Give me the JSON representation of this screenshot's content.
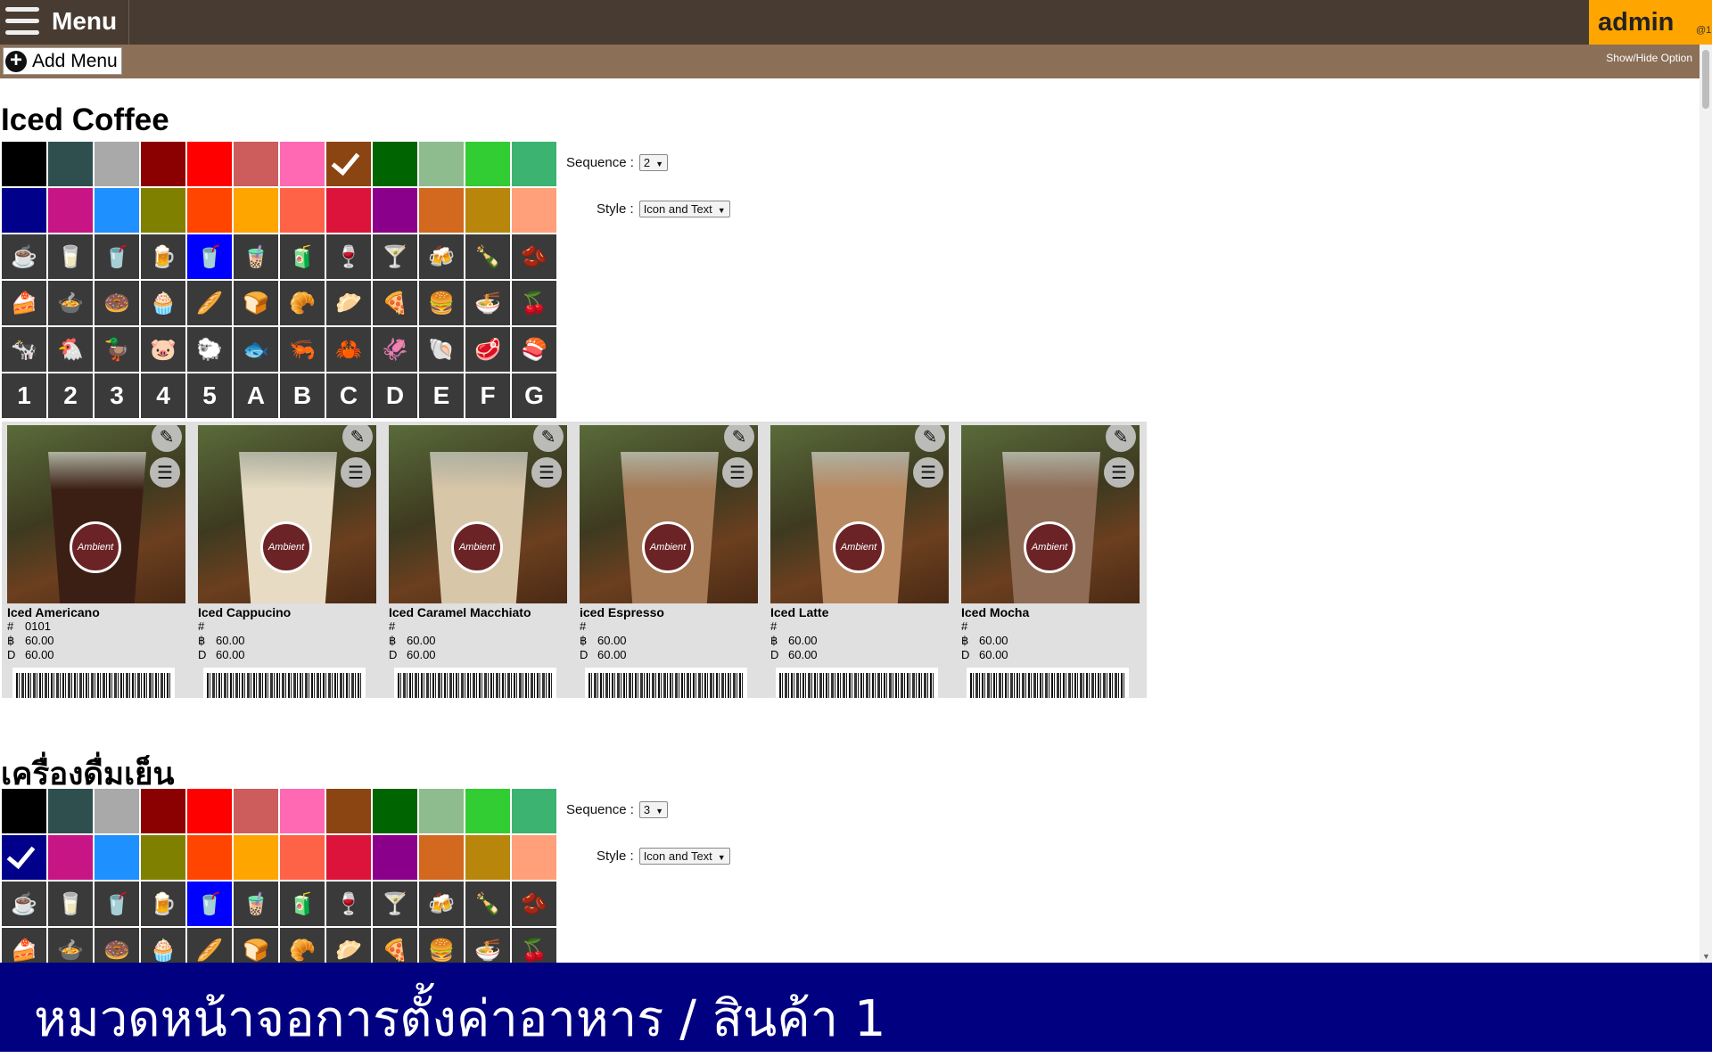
{
  "header": {
    "menu_label": "Menu",
    "user": "admin",
    "user_sub": "@1"
  },
  "toolbar": {
    "add_menu_label": "Add Menu",
    "show_hide_label": "Show/Hide Option"
  },
  "colors": [
    "#000000",
    "#2f4f4f",
    "#a9a9a9",
    "#8b0000",
    "#ff0000",
    "#cd5c5c",
    "#ff69b4",
    "#8b4513",
    "#006400",
    "#8fbc8f",
    "#32cd32",
    "#3cb371",
    "#00008b",
    "#c71585",
    "#1e90ff",
    "#808000",
    "#ff4500",
    "#ffa500",
    "#ff6347",
    "#dc143c",
    "#8b008b",
    "#d2691e",
    "#b8860b",
    "#ffa07a"
  ],
  "icons_row1": [
    "☕",
    "🥛",
    "🥤",
    "🍺",
    "🥤",
    "🧋",
    "🧃",
    "🍷",
    "🍸",
    "🍻",
    "🍾",
    "🫘"
  ],
  "icons_row2": [
    "🍰",
    "🍲",
    "🍩",
    "🧁",
    "🥖",
    "🍞",
    "🥐",
    "🥟",
    "🍕",
    "🍔",
    "🍜",
    "🍒"
  ],
  "icons_row3": [
    "🐄",
    "🐔",
    "🦆",
    "🐷",
    "🐑",
    "🐟",
    "🦐",
    "🦀",
    "🦑",
    "🐚",
    "🥩",
    "🍣"
  ],
  "icons_row4": [
    "1",
    "2",
    "3",
    "4",
    "5",
    "A",
    "B",
    "C",
    "D",
    "E",
    "F",
    "G"
  ],
  "sequence_label": "Sequence :",
  "style_label": "Style :",
  "categories": [
    {
      "title": "Iced Coffee",
      "sequence": "2",
      "style": "Icon and Text",
      "selected_color_index": 7,
      "selected_icon_index": 4,
      "products": [
        {
          "name": "Iced Americano",
          "code": "0101",
          "price_b": "60.00",
          "price_d": "60.00",
          "liquid": "#3b1f14"
        },
        {
          "name": "Iced Cappucino",
          "code": "",
          "price_b": "60.00",
          "price_d": "60.00",
          "liquid": "#e7dcc3"
        },
        {
          "name": "Iced Caramel Macchiato",
          "code": "",
          "price_b": "60.00",
          "price_d": "60.00",
          "liquid": "#d8c6a8"
        },
        {
          "name": "iced Espresso",
          "code": "",
          "price_b": "60.00",
          "price_d": "60.00",
          "liquid": "#a57a55"
        },
        {
          "name": "Iced Latte",
          "code": "",
          "price_b": "60.00",
          "price_d": "60.00",
          "liquid": "#b98a62"
        },
        {
          "name": "Iced Mocha",
          "code": "",
          "price_b": "60.00",
          "price_d": "60.00",
          "liquid": "#8f6c55"
        }
      ]
    },
    {
      "title": "เครื่องดื่มเย็น",
      "sequence": "3",
      "style": "Icon and Text",
      "selected_color_index": 12,
      "selected_icon_index": 4
    }
  ],
  "row_labels": {
    "code": "#",
    "price_b": "฿",
    "price_d": "D"
  },
  "banner_text": "หมวดหน้าจอการตั้งค่าอาหาร / สินค้า 1"
}
